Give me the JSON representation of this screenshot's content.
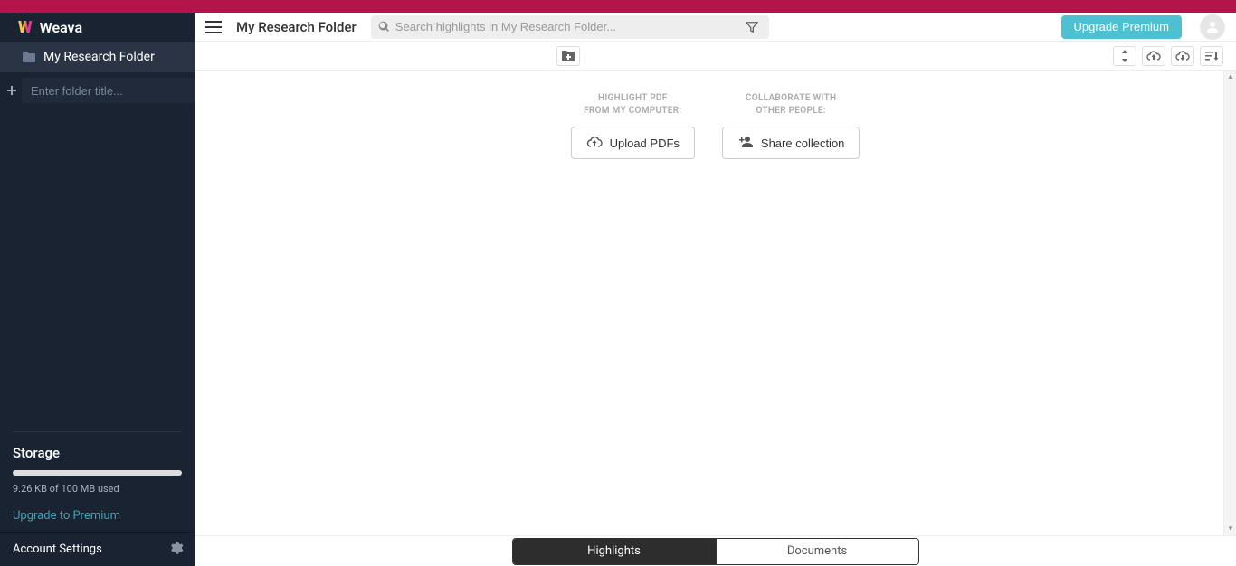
{
  "brand": {
    "name": "Weava"
  },
  "sidebar": {
    "folders": [
      {
        "label": "My Research Folder"
      }
    ],
    "new_folder_placeholder": "Enter folder title...",
    "storage": {
      "title": "Storage",
      "used_text": "9.26 KB of 100 MB used",
      "upgrade_label": "Upgrade to Premium"
    },
    "account_label": "Account Settings"
  },
  "header": {
    "title": "My Research Folder",
    "search_placeholder": "Search highlights in My Research Folder...",
    "upgrade_label": "Upgrade Premium"
  },
  "emptystate": {
    "upload_caption": "HIGHLIGHT PDF\nFROM MY COMPUTER:",
    "upload_label": "Upload PDFs",
    "share_caption": "COLLABORATE WITH\nOTHER PEOPLE:",
    "share_label": "Share collection"
  },
  "tabs": {
    "highlights": "Highlights",
    "documents": "Documents"
  }
}
